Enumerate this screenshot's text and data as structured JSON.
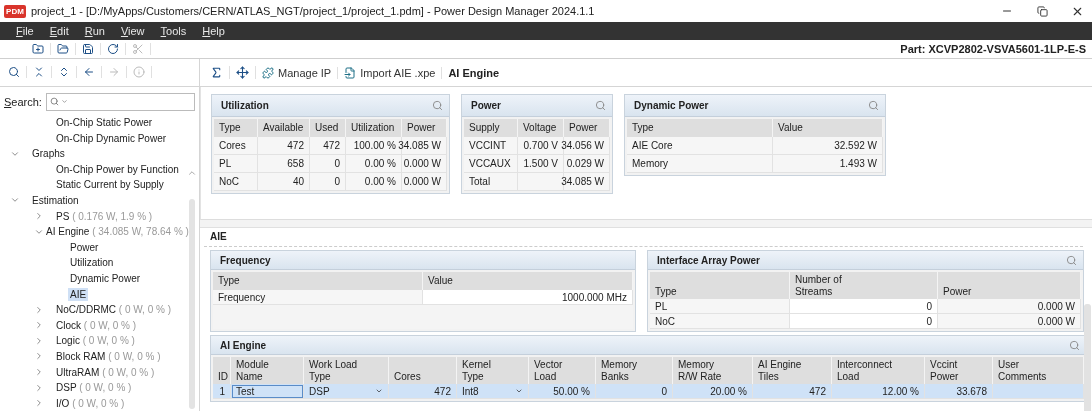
{
  "window": {
    "title": "project_1 - [D:/MyApps/Customers/CERN/ATLAS_NGT/project_1/project_1.pdm] - Power Design Manager 2024.1.1",
    "app_badge": "PDM"
  },
  "menu": [
    "File",
    "Edit",
    "Run",
    "View",
    "Tools",
    "Help"
  ],
  "toolbar": [
    {
      "kind": "new",
      "disabled": false
    },
    {
      "kind": "open",
      "disabled": false
    },
    {
      "kind": "save",
      "disabled": false
    },
    {
      "kind": "refresh",
      "disabled": false
    },
    {
      "kind": "cut",
      "disabled": true
    }
  ],
  "part": "Part: XCVP2802-VSVA5601-1LP-E-S",
  "sidebar": {
    "tools": [
      {
        "kind": "search",
        "disabled": false
      },
      {
        "kind": "collapse",
        "disabled": false
      },
      {
        "kind": "expand",
        "disabled": false
      },
      {
        "kind": "back",
        "disabled": false
      },
      {
        "kind": "forward",
        "disabled": true
      },
      {
        "kind": "info",
        "disabled": true
      }
    ],
    "search": {
      "label": "Search:"
    },
    "tree": [
      {
        "label": "On-Chip Static Power",
        "selected": false
      },
      {
        "label": "On-Chip Dynamic Power",
        "selected": false
      },
      {
        "label": "Graphs",
        "selected": false,
        "expanded": true,
        "children": [
          {
            "label": "On-Chip Power by Function",
            "selected": false
          },
          {
            "label": "Static Current by Supply",
            "selected": false
          }
        ]
      },
      {
        "label": "Estimation",
        "selected": false,
        "expanded": true,
        "children": [
          {
            "label": "PS",
            "detail": "( 0.176 W, 1.9 % )",
            "selected": false,
            "expanded": false
          },
          {
            "label": "AI Engine",
            "detail": "( 34.085 W, 78.64 % )",
            "selected": false,
            "expanded": true,
            "children": [
              {
                "label": "Power",
                "selected": false
              },
              {
                "label": "Utilization",
                "selected": false
              },
              {
                "label": "Dynamic Power",
                "selected": false
              },
              {
                "label": "AIE",
                "selected": true
              }
            ]
          },
          {
            "label": "NoC/DDRMC",
            "detail": "( 0 W, 0 % )",
            "selected": false,
            "expanded": false
          },
          {
            "label": "Clock",
            "detail": "( 0 W, 0 % )",
            "selected": false,
            "expanded": false
          },
          {
            "label": "Logic",
            "detail": "( 0 W, 0 % )",
            "selected": false,
            "expanded": false
          },
          {
            "label": "Block RAM",
            "detail": "( 0 W, 0 % )",
            "selected": false,
            "expanded": false
          },
          {
            "label": "UltraRAM",
            "detail": "( 0 W, 0 % )",
            "selected": false,
            "expanded": false
          },
          {
            "label": "DSP",
            "detail": "( 0 W, 0 % )",
            "selected": false,
            "expanded": false
          },
          {
            "label": "I/O",
            "detail": "( 0 W, 0 % )",
            "selected": false,
            "expanded": false
          }
        ]
      }
    ]
  },
  "main_toolbar": {
    "buttons": [
      {
        "kind": "sum"
      },
      {
        "kind": "move"
      },
      {
        "kind": "manage",
        "label": "Manage IP"
      },
      {
        "kind": "import",
        "label": "Import AIE .xpe"
      }
    ],
    "title": "AI Engine"
  },
  "summary": {
    "utilization": {
      "title": "Utilization",
      "search": true,
      "columns": [
        "Type",
        "Available",
        "Used",
        "Utilization",
        "Power"
      ],
      "rows": [
        [
          "Cores",
          "472",
          "472",
          "100.00 %",
          "34.085 W"
        ],
        [
          "PL",
          "658",
          "0",
          "0.00 %",
          "0.000 W"
        ],
        [
          "NoC",
          "40",
          "0",
          "0.00 %",
          "0.000 W"
        ]
      ]
    },
    "power": {
      "title": "Power",
      "search": true,
      "columns": [
        "Supply",
        "Voltage",
        "Power"
      ],
      "rows": [
        [
          "VCCINT",
          "0.700 V",
          "34.056 W"
        ],
        [
          "VCCAUX",
          "1.500 V",
          "0.029 W"
        ],
        [
          "Total",
          "",
          "34.085 W"
        ]
      ]
    },
    "dynamic_power": {
      "title": "Dynamic Power",
      "search": true,
      "columns": [
        "Type",
        "Value"
      ],
      "rows": [
        [
          "AIE Core",
          "32.592 W"
        ],
        [
          "Memory",
          "1.493 W"
        ]
      ]
    }
  },
  "aie": {
    "title": "AIE",
    "frequency": {
      "title": "Frequency",
      "search": false,
      "columns": [
        "Type",
        "Value"
      ],
      "rows": [
        [
          "Frequency",
          "1000.000 MHz"
        ]
      ]
    },
    "interface_array_power": {
      "title": "Interface Array Power",
      "search": true,
      "columns": [
        "Type",
        "Number of\nStreams",
        "Power"
      ],
      "rows": [
        [
          "PL",
          "0",
          "0.000 W"
        ],
        [
          "NoC",
          "0",
          "0.000 W"
        ]
      ]
    },
    "ai_engine": {
      "title": "AI Engine",
      "search": true,
      "columns": [
        "ID",
        "Module\nName",
        "Work Load\nType",
        "Cores",
        "Kernel\nType",
        "Vector\nLoad",
        "Memory\nBanks",
        "Memory\nR/W Rate",
        "AI Engine\nTiles",
        "Interconnect\nLoad",
        "Vccint\nPower",
        "User\nComments"
      ],
      "rows": [
        {
          "selected": true,
          "cells": [
            "1",
            "Test",
            "DSP",
            "472",
            "Int8",
            "50.00 %",
            "0",
            "20.00 %",
            "472",
            "12.00 %",
            "33.678",
            ""
          ]
        }
      ]
    }
  }
}
